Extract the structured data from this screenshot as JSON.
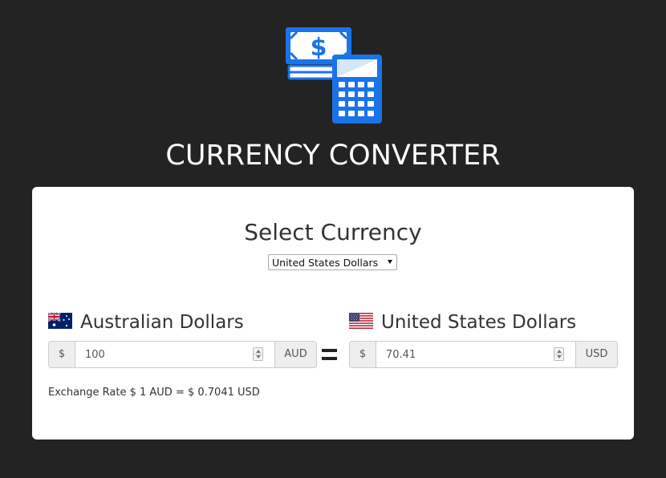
{
  "app": {
    "title": "CURRENCY CONVERTER",
    "logo_icon": "money-calculator-icon",
    "accent_color": "#1a73e8"
  },
  "selector": {
    "heading": "Select Currency",
    "selected": "United States Dollars"
  },
  "from_currency": {
    "name": "Australian Dollars",
    "flag_icon": "australia-flag-icon",
    "symbol": "$",
    "amount": "100",
    "code": "AUD"
  },
  "to_currency": {
    "name": "United States Dollars",
    "flag_icon": "usa-flag-icon",
    "symbol": "$",
    "amount": "70.41",
    "code": "USD"
  },
  "rate_text": "Exchange Rate $ 1 AUD = $ 0.7041 USD"
}
